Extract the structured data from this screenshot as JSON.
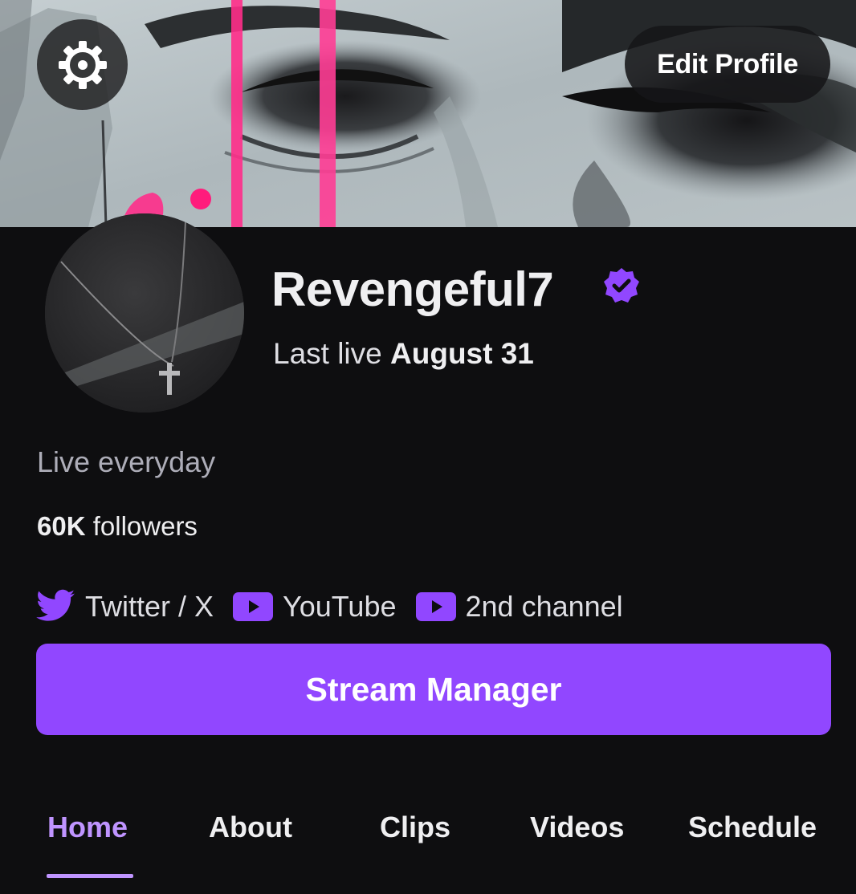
{
  "header": {
    "edit_profile_label": "Edit Profile",
    "settings_icon": "gear-icon"
  },
  "profile": {
    "channel_name": "Revengeful7",
    "verified_icon": "verified-badge-icon",
    "last_live_prefix": "Last live",
    "last_live_date": "August 31",
    "bio": "Live everyday",
    "followers_count": "60K",
    "followers_label": "followers"
  },
  "links": [
    {
      "label": "Twitter / X",
      "icon": "twitter-icon"
    },
    {
      "label": "YouTube",
      "icon": "youtube-icon"
    },
    {
      "label": "2nd channel",
      "icon": "youtube-icon"
    }
  ],
  "actions": {
    "stream_manager_label": "Stream Manager"
  },
  "tabs": [
    {
      "label": "Home",
      "active": true
    },
    {
      "label": "About",
      "active": false
    },
    {
      "label": "Clips",
      "active": false
    },
    {
      "label": "Videos",
      "active": false
    },
    {
      "label": "Schedule",
      "active": false
    }
  ],
  "colors": {
    "background": "#0e0e10",
    "accent": "#9147ff",
    "accent_light": "#bf94ff",
    "banner_pink": "#ff2d8a"
  }
}
